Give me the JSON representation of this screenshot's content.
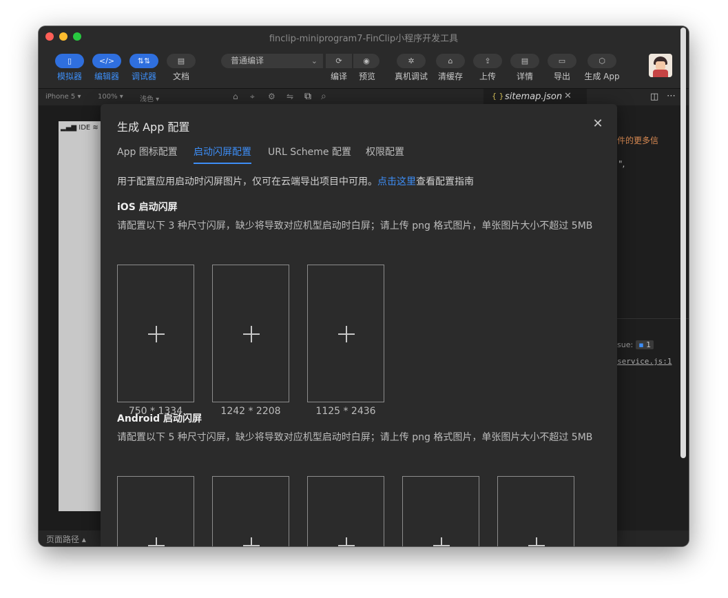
{
  "window": {
    "title": "finclip-miniprogram7-FinClip小程序开发工具"
  },
  "toolbar": {
    "simulator": {
      "label": "模拟器",
      "icon": "phone-icon"
    },
    "editor": {
      "label": "编辑器",
      "icon": "code-icon"
    },
    "debugger": {
      "label": "调试器",
      "icon": "sliders-icon"
    },
    "docs": {
      "label": "文档",
      "icon": "document-icon"
    },
    "compile_mode": "普通编译",
    "compile": {
      "label": "编译",
      "icon": "refresh-icon"
    },
    "preview": {
      "label": "预览",
      "icon": "eye-icon"
    },
    "real_debug": {
      "label": "真机调试",
      "icon": "bug-icon"
    },
    "clear_cache": {
      "label": "清缓存",
      "icon": "storage-icon"
    },
    "upload": {
      "label": "上传",
      "icon": "upload-icon"
    },
    "details": {
      "label": "详情",
      "icon": "document-icon"
    },
    "export": {
      "label": "导出",
      "icon": "folder-icon"
    },
    "generate_app": {
      "label": "生成 App",
      "icon": "cube-icon"
    }
  },
  "subbar": {
    "device": "iPhone 5 ▾",
    "zoom": "100% ▾",
    "theme": "浅色 ▾",
    "file_tab": "sitemap.json"
  },
  "simulator": {
    "status": "IDE",
    "bottom_label": "页面路径 ▴"
  },
  "editor_peek": {
    "line1": "件的更多信",
    "line2": "\",",
    "issue_label": "sue:",
    "issue_count": "1",
    "service_link": "service.js:1"
  },
  "modal": {
    "title": "生成 App 配置",
    "tabs": [
      {
        "label": "App 图标配置"
      },
      {
        "label": "启动闪屏配置"
      },
      {
        "label": "URL Scheme 配置"
      },
      {
        "label": "权限配置"
      }
    ],
    "active_tab": 1,
    "desc_prefix": "用于配置应用启动时闪屏图片，仅可在云端导出项目中可用。",
    "desc_link": "点击这里",
    "desc_suffix": "查看配置指南",
    "ios": {
      "title": "iOS 启动闪屏",
      "hint": "请配置以下 3 种尺寸闪屏，缺少将导致对应机型启动时白屏；请上传 png 格式图片，单张图片大小不超过 5MB",
      "sizes": [
        "750 * 1334",
        "1242 * 2208",
        "1125 * 2436"
      ]
    },
    "android": {
      "title": "Android 启动闪屏",
      "hint": "请配置以下 5 种尺寸闪屏，缺少将导致对应机型启动时白屏；请上传 png 格式图片，单张图片大小不超过 5MB",
      "count": 5
    }
  },
  "colors": {
    "accent": "#3d8ef7",
    "modal_bg": "#2b2b2b"
  }
}
